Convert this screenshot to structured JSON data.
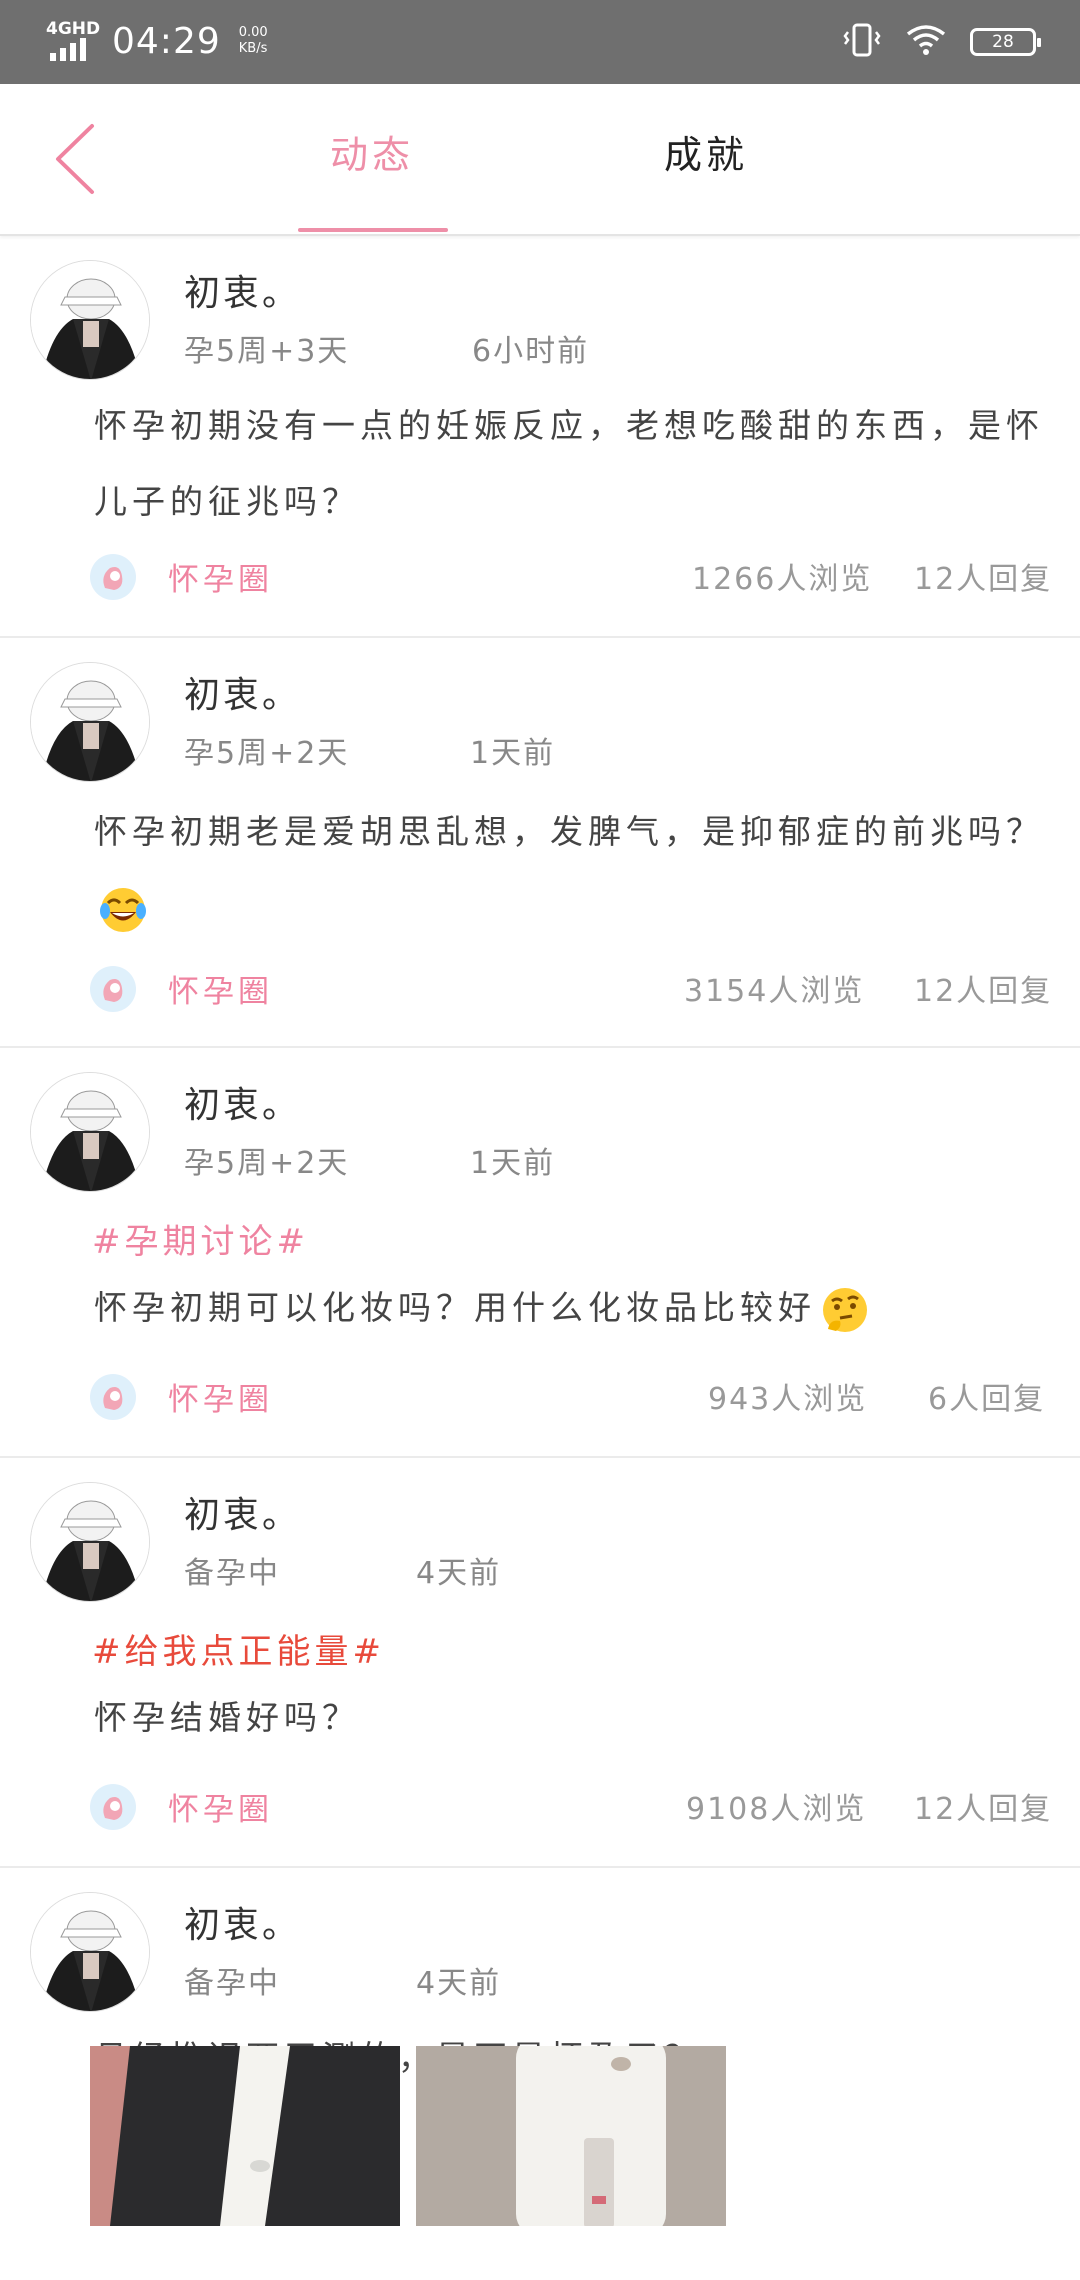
{
  "status_bar": {
    "network": "4GHD",
    "time": "04:29",
    "speed_value": "0.00",
    "speed_unit": "KB/s",
    "battery": "28"
  },
  "header": {
    "tabs": [
      {
        "label": "动态",
        "active": true
      },
      {
        "label": "成就",
        "active": false
      }
    ],
    "accent_color": "#ee8fa8"
  },
  "posts": [
    {
      "username": "初衷。",
      "stage": "孕5周+3天",
      "time": "6小时前",
      "topic": "",
      "content": "怀孕初期没有一点的妊娠反应，老想吃酸甜的东西，是怀儿子的征兆吗？",
      "circle": "怀孕圈",
      "views": "1266人浏览",
      "replies": "12人回复"
    },
    {
      "username": "初衷。",
      "stage": "孕5周+2天",
      "time": "1天前",
      "topic": "",
      "content": "怀孕初期老是爱胡思乱想，发脾气，是抑郁症的前兆吗？",
      "emoji": "laughing-tears-emoji",
      "circle": "怀孕圈",
      "views": "3154人浏览",
      "replies": "12人回复"
    },
    {
      "username": "初衷。",
      "stage": "孕5周+2天",
      "time": "1天前",
      "topic": "#孕期讨论#",
      "topic_color": "#ef83a0",
      "content": "怀孕初期可以化妆吗？用什么化妆品比较好",
      "emoji": "thinking-emoji",
      "circle": "怀孕圈",
      "views": "943人浏览",
      "replies": "6人回复"
    },
    {
      "username": "初衷。",
      "stage": "备孕中",
      "time": "4天前",
      "topic": "#给我点正能量#",
      "topic_color": "#e84a3b",
      "content": "怀孕结婚好吗？",
      "circle": "怀孕圈",
      "views": "9108人浏览",
      "replies": "12人回复"
    },
    {
      "username": "初衷。",
      "stage": "备孕中",
      "time": "4天前",
      "topic": "",
      "content": "月经推迟两天测的，是不是怀孕了？",
      "photos": [
        "photo-1",
        "photo-2"
      ]
    }
  ]
}
